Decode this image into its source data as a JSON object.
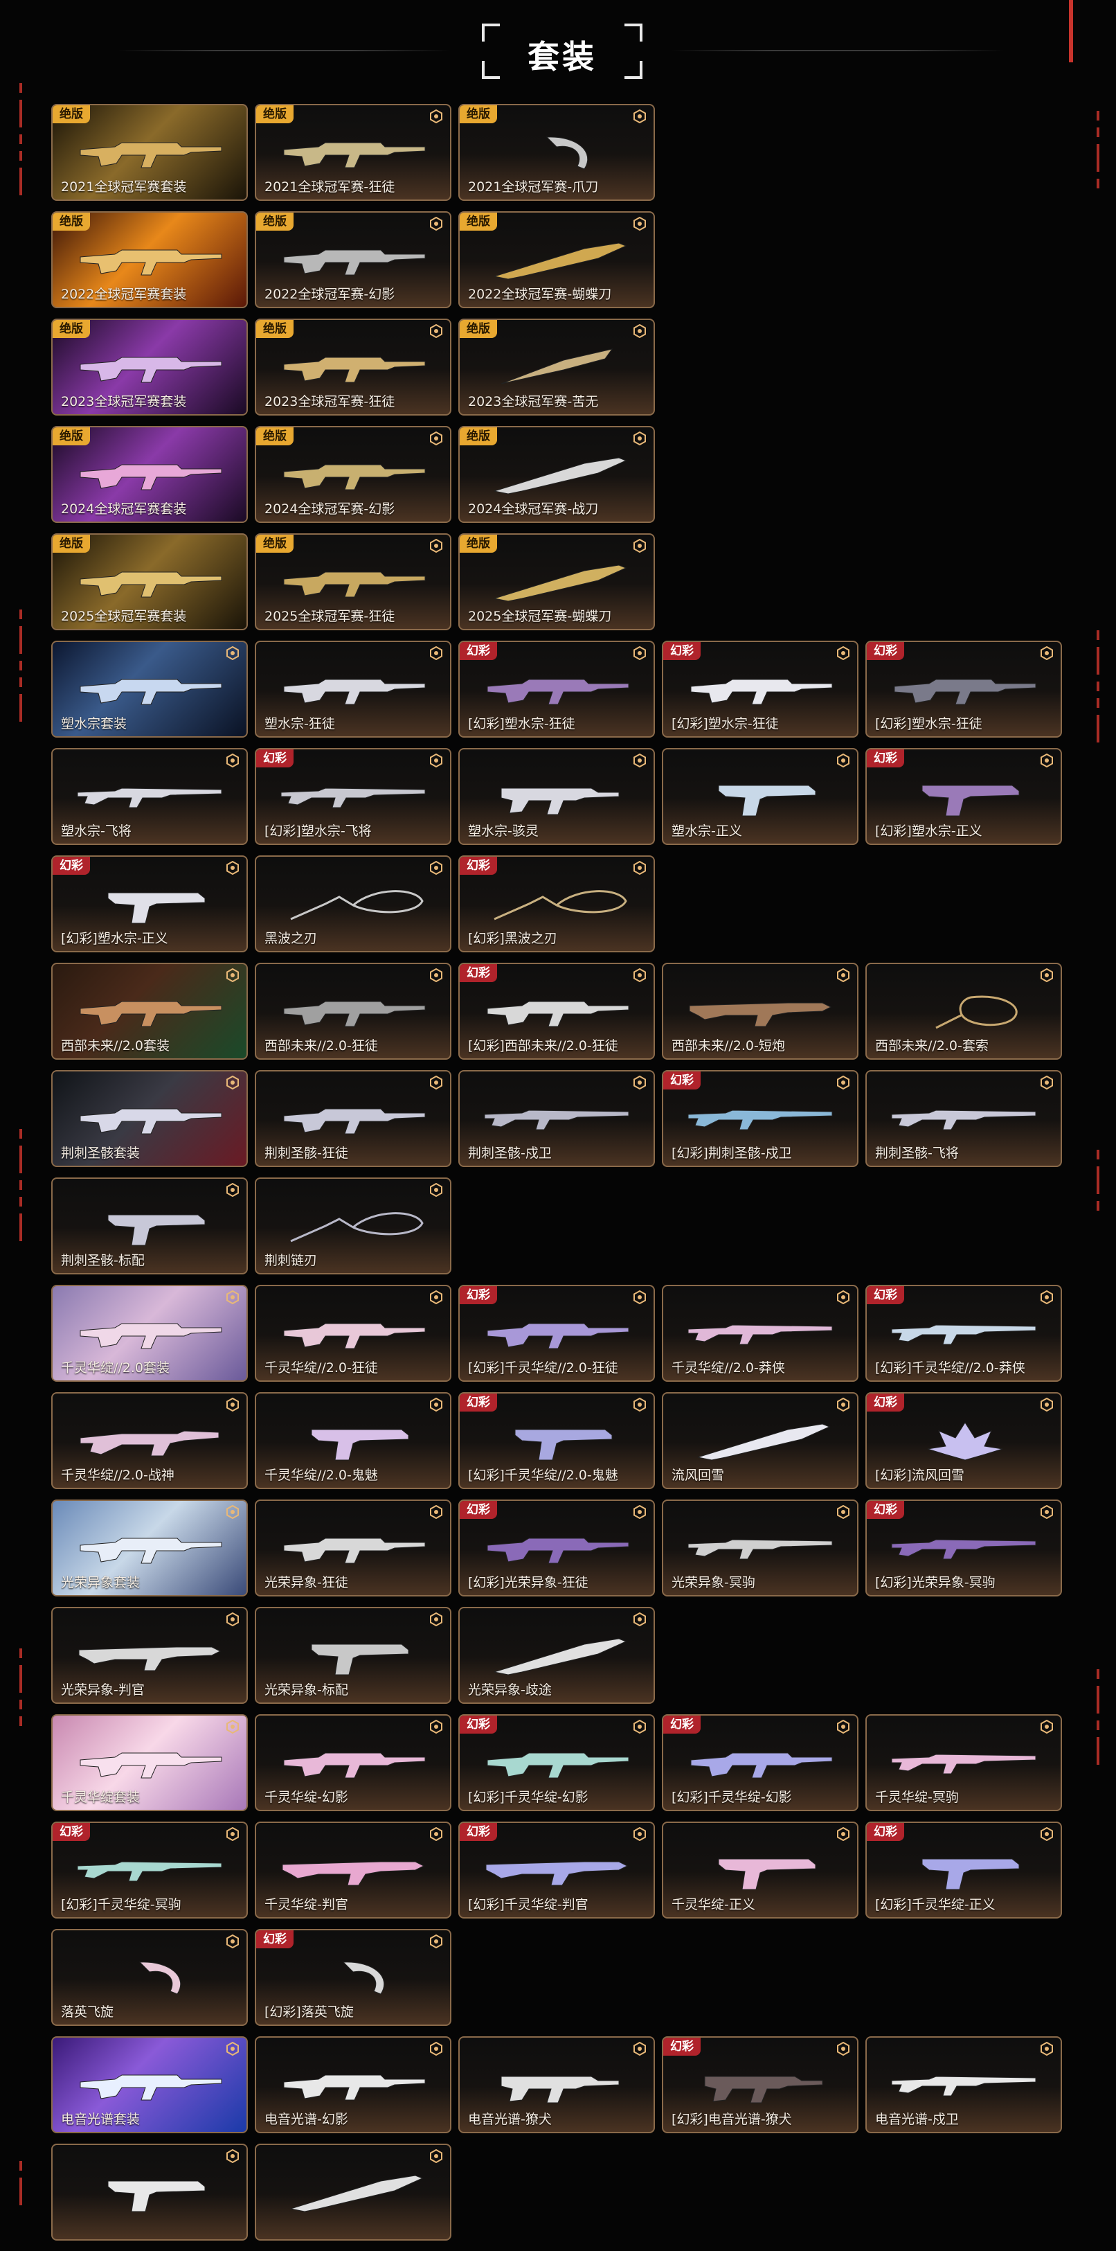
{
  "page": {
    "title": "套装",
    "accent_color": "#c8342c",
    "card_border_color": "#8a6a4a"
  },
  "badges": {
    "jb": "绝版",
    "hc": "幻彩"
  },
  "rows": [
    [
      {
        "name": "2021全球冠军赛套装",
        "badge": "jb",
        "bundle": "gold",
        "weapon": "rifle",
        "color": "#d8b060"
      },
      {
        "name": "2021全球冠军赛-狂徒",
        "badge": "jb",
        "weapon": "rifle",
        "color": "#c8b888"
      },
      {
        "name": "2021全球冠军赛-爪刀",
        "badge": "jb",
        "weapon": "karambit",
        "color": "#c8c8c8"
      }
    ],
    [
      {
        "name": "2022全球冠军赛套装",
        "badge": "jb",
        "bundle": "orange",
        "weapon": "rifle",
        "color": "#e8c070"
      },
      {
        "name": "2022全球冠军赛-幻影",
        "badge": "jb",
        "weapon": "rifle",
        "color": "#b8b8b8"
      },
      {
        "name": "2022全球冠军赛-蝴蝶刀",
        "badge": "jb",
        "weapon": "knife",
        "color": "#d0a850"
      }
    ],
    [
      {
        "name": "2023全球冠军赛套装",
        "badge": "jb",
        "bundle": "violet",
        "weapon": "rifle",
        "color": "#d8b8e8"
      },
      {
        "name": "2023全球冠军赛-狂徒",
        "badge": "jb",
        "weapon": "rifle",
        "color": "#d0b070"
      },
      {
        "name": "2023全球冠军赛-苦无",
        "badge": "jb",
        "weapon": "kunai",
        "color": "#c8b080"
      }
    ],
    [
      {
        "name": "2024全球冠军赛套装",
        "badge": "jb",
        "bundle": "violet",
        "weapon": "rifle",
        "color": "#e8a8d8"
      },
      {
        "name": "2024全球冠军赛-幻影",
        "badge": "jb",
        "weapon": "rifle",
        "color": "#c8b070"
      },
      {
        "name": "2024全球冠军赛-战刀",
        "badge": "jb",
        "weapon": "knife",
        "color": "#d8d8d8"
      }
    ],
    [
      {
        "name": "2025全球冠军赛套装",
        "badge": "jb",
        "bundle": "gold",
        "weapon": "rifle",
        "color": "#e0c070"
      },
      {
        "name": "2025全球冠军赛-狂徒",
        "badge": "jb",
        "weapon": "rifle",
        "color": "#c8a860"
      },
      {
        "name": "2025全球冠军赛-蝴蝶刀",
        "badge": "jb",
        "weapon": "knife",
        "color": "#d0b060"
      }
    ],
    [
      {
        "name": "塑水宗套装",
        "bundle": "blue",
        "weapon": "rifle",
        "color": "#c8d8f0"
      },
      {
        "name": "塑水宗-狂徒",
        "weapon": "rifle",
        "color": "#d8d8e0"
      },
      {
        "name": "[幻彩]塑水宗-狂徒",
        "badge": "hc",
        "weapon": "rifle",
        "color": "#9a7ab8"
      },
      {
        "name": "[幻彩]塑水宗-狂徒",
        "badge": "hc",
        "weapon": "rifle",
        "color": "#e8e8ee"
      },
      {
        "name": "[幻彩]塑水宗-狂徒",
        "badge": "hc",
        "weapon": "rifle",
        "color": "#7a7a8a"
      }
    ],
    [
      {
        "name": "塑水宗-飞将",
        "weapon": "sniper",
        "color": "#d8d8e0"
      },
      {
        "name": "[幻彩]塑水宗-飞将",
        "badge": "hc",
        "weapon": "sniper",
        "color": "#c8c8d0"
      },
      {
        "name": "塑水宗-骇灵",
        "weapon": "smg",
        "color": "#d8d8e0"
      },
      {
        "name": "塑水宗-正义",
        "weapon": "pistol",
        "color": "#c8d8e8"
      },
      {
        "name": "[幻彩]塑水宗-正义",
        "badge": "hc",
        "weapon": "pistol",
        "color": "#9a7ab8"
      }
    ],
    [
      {
        "name": "[幻彩]塑水宗-正义",
        "badge": "hc",
        "weapon": "pistol",
        "color": "#e0e0e8"
      },
      {
        "name": "黑波之刃",
        "weapon": "chain",
        "color": "#c8c8c8"
      },
      {
        "name": "[幻彩]黑波之刃",
        "badge": "hc",
        "weapon": "chain",
        "color": "#c8b080"
      }
    ],
    [
      {
        "name": "西部未来//2.0套装",
        "bundle": "green",
        "weapon": "rifle",
        "color": "#c89060"
      },
      {
        "name": "西部未来//2.0-狂徒",
        "weapon": "rifle",
        "color": "#a0a0a0"
      },
      {
        "name": "[幻彩]西部未来//2.0-狂徒",
        "badge": "hc",
        "weapon": "rifle",
        "color": "#d8d8d8"
      },
      {
        "name": "西部未来//2.0-短炮",
        "weapon": "shotgun",
        "color": "#a07858"
      },
      {
        "name": "西部未来//2.0-套索",
        "weapon": "lasso",
        "color": "#c8a870"
      }
    ],
    [
      {
        "name": "荆刺圣骸套装",
        "bundle": "red",
        "weapon": "rifle",
        "color": "#d8d8e8"
      },
      {
        "name": "荆刺圣骸-狂徒",
        "weapon": "rifle",
        "color": "#c8c8d8"
      },
      {
        "name": "荆刺圣骸-戍卫",
        "weapon": "sniper",
        "color": "#b8b8c8"
      },
      {
        "name": "[幻彩]荆刺圣骸-戍卫",
        "badge": "hc",
        "weapon": "sniper",
        "color": "#8ab8d8"
      },
      {
        "name": "荆刺圣骸-飞将",
        "weapon": "sniper",
        "color": "#c8c8d8"
      }
    ],
    [
      {
        "name": "荆刺圣骸-标配",
        "weapon": "pistol",
        "color": "#c8c8d8"
      },
      {
        "name": "荆刺链刃",
        "weapon": "chain",
        "color": "#b8b8c8"
      }
    ],
    [
      {
        "name": "千灵华绽//2.0套装",
        "bundle": "pink",
        "weapon": "rifle",
        "color": "#f0d8e8"
      },
      {
        "name": "千灵华绽//2.0-狂徒",
        "weapon": "rifle",
        "color": "#e8c8d8"
      },
      {
        "name": "[幻彩]千灵华绽//2.0-狂徒",
        "badge": "hc",
        "weapon": "rifle",
        "color": "#a898d8"
      },
      {
        "name": "千灵华绽//2.0-莽侠",
        "weapon": "sniper",
        "color": "#e0b8d8"
      },
      {
        "name": "[幻彩]千灵华绽//2.0-莽侠",
        "badge": "hc",
        "weapon": "sniper",
        "color": "#c8d8e8"
      }
    ],
    [
      {
        "name": "千灵华绽//2.0-战神",
        "weapon": "lmg",
        "color": "#e0c0d8"
      },
      {
        "name": "千灵华绽//2.0-鬼魅",
        "weapon": "pistol",
        "color": "#d8c0e8"
      },
      {
        "name": "[幻彩]千灵华绽//2.0-鬼魅",
        "badge": "hc",
        "weapon": "pistol",
        "color": "#a8a8e0"
      },
      {
        "name": "流风回雪",
        "weapon": "knife",
        "color": "#e8e8f0"
      },
      {
        "name": "[幻彩]流风回雪",
        "badge": "hc",
        "weapon": "flower",
        "color": "#c8c0f0"
      }
    ],
    [
      {
        "name": "光荣异象套装",
        "bundle": "sky",
        "weapon": "rifle",
        "color": "#e8eef8"
      },
      {
        "name": "光荣异象-狂徒",
        "weapon": "rifle",
        "color": "#d8d8d8"
      },
      {
        "name": "[幻彩]光荣异象-狂徒",
        "badge": "hc",
        "weapon": "rifle",
        "color": "#8a6ab8"
      },
      {
        "name": "光荣异象-冥驹",
        "weapon": "sniper",
        "color": "#d0d0d0"
      },
      {
        "name": "[幻彩]光荣异象-冥驹",
        "badge": "hc",
        "weapon": "sniper",
        "color": "#8a6ab8"
      }
    ],
    [
      {
        "name": "光荣异象-判官",
        "weapon": "shotgun",
        "color": "#d8d8d8"
      },
      {
        "name": "光荣异象-标配",
        "weapon": "pistol",
        "color": "#c8c8c8"
      },
      {
        "name": "光荣异象-歧途",
        "weapon": "knife",
        "color": "#e0e0e0"
      }
    ],
    [
      {
        "name": "千灵华绽套装",
        "bundle": "rose",
        "weapon": "rifle",
        "color": "#f8e0ee"
      },
      {
        "name": "千灵华绽-幻影",
        "weapon": "rifle",
        "color": "#e8b8d8"
      },
      {
        "name": "[幻彩]千灵华绽-幻影",
        "badge": "hc",
        "weapon": "rifle",
        "color": "#a8d8d0"
      },
      {
        "name": "[幻彩]千灵华绽-幻影",
        "badge": "hc",
        "weapon": "rifle",
        "color": "#a8a8e8"
      },
      {
        "name": "千灵华绽-冥驹",
        "weapon": "sniper",
        "color": "#e8b8d8"
      }
    ],
    [
      {
        "name": "[幻彩]千灵华绽-冥驹",
        "badge": "hc",
        "weapon": "sniper",
        "color": "#a8d8d0"
      },
      {
        "name": "千灵华绽-判官",
        "weapon": "shotgun",
        "color": "#e8a8d0"
      },
      {
        "name": "[幻彩]千灵华绽-判官",
        "badge": "hc",
        "weapon": "shotgun",
        "color": "#a8a8e8"
      },
      {
        "name": "千灵华绽-正义",
        "weapon": "pistol",
        "color": "#e8b8d8"
      },
      {
        "name": "[幻彩]千灵华绽-正义",
        "badge": "hc",
        "weapon": "pistol",
        "color": "#a8a8e8"
      }
    ],
    [
      {
        "name": "落英飞旋",
        "weapon": "karambit",
        "color": "#e8c8d8"
      },
      {
        "name": "[幻彩]落英飞旋",
        "badge": "hc",
        "weapon": "karambit",
        "color": "#d8d8d8"
      }
    ],
    [
      {
        "name": "电音光谱套装",
        "bundle": "neon",
        "weapon": "rifle",
        "color": "#e8f0ff"
      },
      {
        "name": "电音光谱-幻影",
        "weapon": "rifle",
        "color": "#e8e8e8"
      },
      {
        "name": "电音光谱-獠犬",
        "weapon": "smg",
        "color": "#e0e0e0"
      },
      {
        "name": "[幻彩]电音光谱-獠犬",
        "badge": "hc",
        "weapon": "smg",
        "color": "#6a5a5a"
      },
      {
        "name": "电音光谱-戍卫",
        "weapon": "sniper",
        "color": "#e8e8e8"
      }
    ],
    [
      {
        "name": "",
        "weapon": "pistol",
        "color": "#e8e8e8"
      },
      {
        "name": "",
        "weapon": "knife",
        "color": "#e0e0e0"
      }
    ]
  ]
}
